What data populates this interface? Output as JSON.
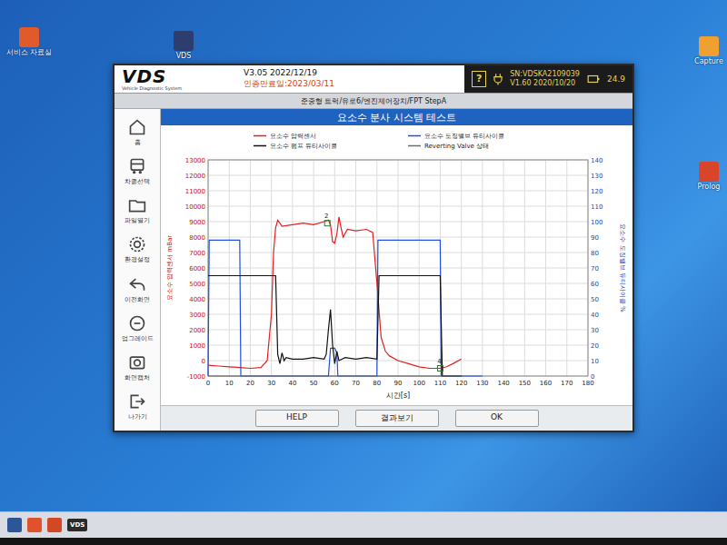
{
  "desktop": {
    "icons": [
      {
        "label": "서비스 자료실"
      },
      {
        "label": "VDS"
      },
      {
        "label": "Capture"
      },
      {
        "label": "Prolog"
      }
    ]
  },
  "window": {
    "logo": "VDS",
    "logo_sub": "Vehicle Diagnostic System",
    "version": "V3.05 2022/12/19",
    "expiry": "인증만료일:2023/03/11",
    "help": "?",
    "serial": "SN:VDSKA2109039",
    "firmware": "V1.60 2020/10/20",
    "battery": "24.9"
  },
  "breadcrumb": "준중형 트럭/유로6/엔진제어장치/FPT StepA",
  "sidebar": {
    "items": [
      {
        "label": "홈"
      },
      {
        "label": "차종선택"
      },
      {
        "label": "파일열기"
      },
      {
        "label": "환경설정"
      },
      {
        "label": "이전화면"
      },
      {
        "label": "업그레이드"
      },
      {
        "label": "화면캡처"
      },
      {
        "label": "나가기"
      }
    ]
  },
  "title": "요소수 분사 시스템 테스트",
  "chart": {
    "y_left": {
      "label": "요소수 압력센서 mBar",
      "min": -1000,
      "max": 13000,
      "ticks": [
        "13000",
        "12000",
        "11000",
        "10000",
        "9000",
        "8000",
        "7000",
        "6000",
        "5000",
        "4000",
        "3000",
        "2000",
        "1000",
        "0",
        "-1000"
      ]
    },
    "y_right": {
      "label": "요소수 도징밸브 듀티사이클 %",
      "min": 0,
      "max": 140,
      "ticks": [
        "140",
        "130",
        "120",
        "110",
        "100",
        "90",
        "80",
        "70",
        "60",
        "50",
        "40",
        "30",
        "20",
        "10",
        "0"
      ]
    },
    "x": {
      "label": "시간[s]",
      "min": 0,
      "max": 180,
      "ticks": [
        "0",
        "10",
        "20",
        "30",
        "40",
        "50",
        "60",
        "70",
        "80",
        "90",
        "100",
        "110",
        "120",
        "130",
        "140",
        "150",
        "160",
        "170",
        "180"
      ]
    },
    "series": [
      {
        "name": "요소수 압력센서",
        "color": "#e02020",
        "axis": "left",
        "x": [
          0,
          5,
          10,
          15,
          20,
          25,
          28,
          30,
          31,
          32,
          33,
          35,
          40,
          45,
          50,
          55,
          57,
          58,
          59,
          60,
          61,
          62,
          63,
          64,
          66,
          70,
          75,
          78,
          80,
          82,
          84,
          86,
          90,
          95,
          100,
          105,
          110,
          113,
          116,
          120
        ],
        "y": [
          -300,
          -350,
          -400,
          -450,
          -500,
          -450,
          0,
          3000,
          7000,
          8600,
          9100,
          8700,
          8800,
          8900,
          8800,
          9000,
          9100,
          8800,
          7700,
          7600,
          8200,
          9300,
          8600,
          8000,
          8500,
          8400,
          8500,
          8300,
          5000,
          1500,
          600,
          300,
          0,
          -200,
          -400,
          -500,
          -500,
          -400,
          -200,
          100
        ]
      },
      {
        "name": "요소수 도징밸브 듀티사이클",
        "color": "#1f4fe0",
        "axis": "right",
        "x": [
          0,
          0.5,
          15,
          15.5,
          57,
          58,
          60,
          61,
          61.5,
          80,
          80.5,
          110,
          110.5,
          130
        ],
        "y": [
          0,
          88,
          88,
          0,
          0,
          18,
          18,
          15,
          0,
          0,
          88,
          88,
          0,
          0
        ]
      },
      {
        "name": "요소수 펌프 듀티사이클",
        "color": "#111111",
        "axis": "right",
        "x": [
          0,
          32,
          33,
          34,
          35,
          36,
          37,
          40,
          45,
          50,
          55,
          56,
          57,
          58,
          59,
          60,
          61,
          62,
          65,
          70,
          75,
          80,
          81,
          110,
          111,
          120
        ],
        "y": [
          65,
          65,
          14,
          8,
          15,
          10,
          12,
          11,
          11,
          12,
          11,
          14,
          30,
          43,
          20,
          8,
          16,
          10,
          12,
          11,
          12,
          11,
          65,
          65,
          0,
          0
        ]
      },
      {
        "name": "Reverting Valve 상태",
        "color": "#6b6b6b",
        "axis": "right",
        "x": [
          0,
          120
        ],
        "y": [
          0,
          0
        ]
      }
    ],
    "markers": [
      {
        "label": "2",
        "x": 56.5,
        "y": 8900
      },
      {
        "label": "4",
        "x": 110,
        "y": -500
      }
    ]
  },
  "buttons": [
    {
      "label": "HELP"
    },
    {
      "label": "결과보기"
    },
    {
      "label": "OK"
    }
  ],
  "taskbar": {
    "apps": [
      {
        "label": "VDS"
      }
    ]
  }
}
